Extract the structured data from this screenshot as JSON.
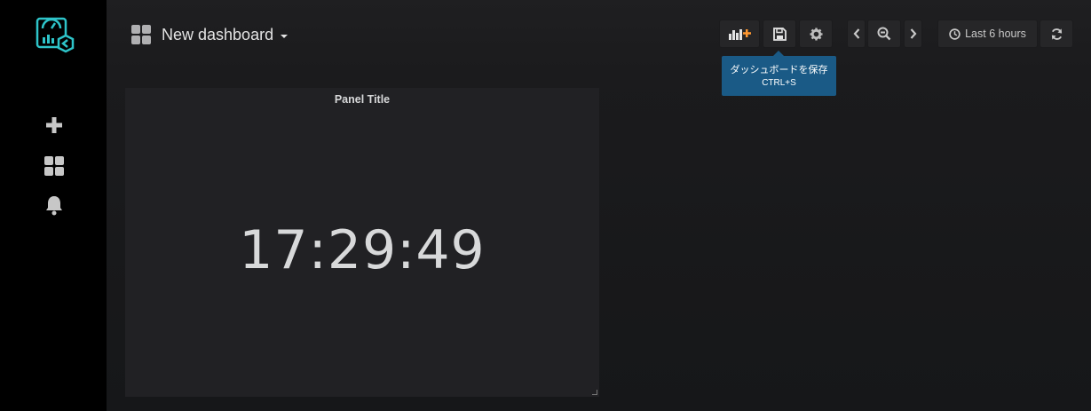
{
  "sidemenu": {
    "logo": "grafana-logo",
    "items": [
      {
        "name": "create",
        "icon": "plus-icon"
      },
      {
        "name": "dashboards",
        "icon": "dashboards-grid-icon"
      },
      {
        "name": "alerting",
        "icon": "bell-icon"
      }
    ]
  },
  "navbar": {
    "title": "New dashboard",
    "buttons": {
      "add_panel_icon": "add-panel-icon",
      "save_icon": "save-icon",
      "settings_icon": "gear-icon",
      "time_back_icon": "chevron-left-icon",
      "zoom_out_icon": "zoom-out-icon",
      "time_forward_icon": "chevron-right-icon",
      "refresh_icon": "refresh-icon"
    },
    "time_picker": {
      "label": "Last 6 hours",
      "icon": "clock-icon"
    }
  },
  "tooltip": {
    "line1": "ダッシュボードを保存",
    "line2": "CTRL+S"
  },
  "panel": {
    "title": "Panel Title",
    "value": "17:29:49"
  },
  "colors": {
    "accent_orange": "#ff9830",
    "logo_cyan": "#33b5e5",
    "tooltip_bg": "#1a5a86"
  }
}
